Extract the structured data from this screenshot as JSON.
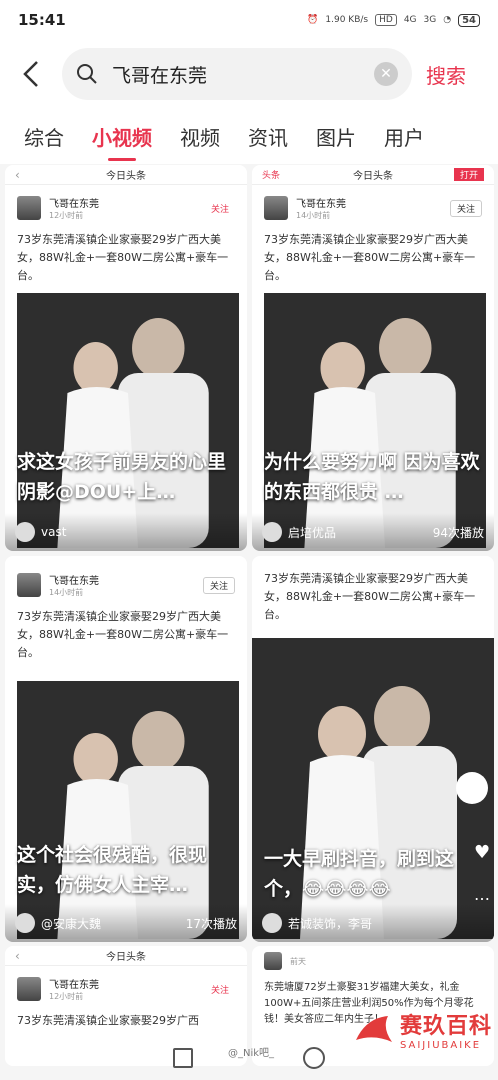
{
  "status": {
    "time": "15:41",
    "speed": "1.90 KB/s",
    "net1": "4G",
    "net2": "3G",
    "hd": "HD",
    "battery": "54"
  },
  "search": {
    "query": "飞哥在东莞",
    "button": "搜索"
  },
  "tabs": [
    "综合",
    "小视频",
    "视频",
    "资讯",
    "图片",
    "用户"
  ],
  "post": {
    "app": "今日头条",
    "name": "飞哥在东莞",
    "time": "12小时前",
    "time2": "14小时前",
    "follow": "关注",
    "text": "73岁东莞清溪镇企业家豪娶29岁广西大美女，88W礼金+一套80W二房公寓+豪车一台。"
  },
  "cards": [
    {
      "caption": "求这女孩子前男友的心里阴影@DOU+上…",
      "author": "vast",
      "plays": ""
    },
    {
      "caption": "为什么要努力啊 因为喜欢的东西都很贵 …",
      "author": "启培优品",
      "plays": "94次播放",
      "tag": "头条",
      "open": "打开"
    },
    {
      "caption": "这个社会很残酷，很现实，仿佛女人主宰…",
      "author": "@安康大魏",
      "plays": "17次播放"
    },
    {
      "caption": "一大早刷抖音，刷到这个，😂😂😂😂",
      "author": "若诚装饰，李哥",
      "plays": ""
    }
  ],
  "bottom_card": {
    "text": "东莞塘厦72岁土豪娶31岁福建大美女，礼金100W+五间茶庄营业利润50%作为每个月零花钱！美女答应二年内生子！",
    "time": "前天"
  },
  "partial_text": "73岁东莞清溪镇企业家豪娶29岁广西",
  "watermark": {
    "weibo": "@_Nik吧_",
    "site": "赛玖百科",
    "site_en": "SAIJIUBAIKE"
  }
}
